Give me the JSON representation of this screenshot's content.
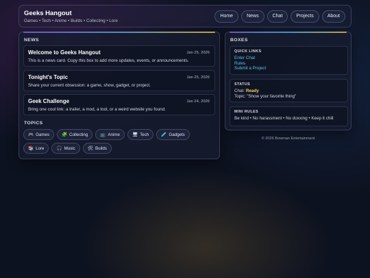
{
  "header": {
    "title": "Geeks Hangout",
    "tagline": "Games • Tech • Anime • Builds • Collecting • Lore",
    "nav": [
      "Home",
      "News",
      "Chat",
      "Projects",
      "About"
    ]
  },
  "news": {
    "heading": "NEWS",
    "cards": [
      {
        "title": "Welcome to Geeks Hangout",
        "date": "Jan 25, 2026",
        "body": "This is a news card. Copy this box to add more updates, events, or announcements."
      },
      {
        "title": "Tonight's Topic",
        "date": "Jan 25, 2026",
        "body": "Share your current obsession: a game, show, gadget, or project."
      },
      {
        "title": "Geek Challenge",
        "date": "Jan 24, 2026",
        "body": "Bring one cool link: a trailer, a mod, a tool, or a weird website you found."
      }
    ]
  },
  "topics": {
    "heading": "TOPICS",
    "chips": [
      {
        "icon": "🎮",
        "icon_name": "game-controller-icon",
        "label": "Games"
      },
      {
        "icon": "🧩",
        "icon_name": "puzzle-piece-icon",
        "label": "Collecting"
      },
      {
        "icon": "📺",
        "icon_name": "tv-icon",
        "label": "Anime"
      },
      {
        "icon": "🖥",
        "icon_name": "desktop-computer-icon",
        "label": "Tech"
      },
      {
        "icon": "🧪",
        "icon_name": "test-tube-icon",
        "label": "Gadgets"
      },
      {
        "icon": "📚",
        "icon_name": "books-icon",
        "label": "Lore"
      },
      {
        "icon": "🎧",
        "icon_name": "headphones-icon",
        "label": "Music"
      },
      {
        "icon": "🛠",
        "icon_name": "tools-icon",
        "label": "Builds"
      }
    ]
  },
  "boxes": {
    "heading": "BOXES",
    "quick_links": {
      "title": "QUICK LINKS",
      "links": [
        "Enter Chat",
        "Rules",
        "Submit a Project"
      ]
    },
    "status": {
      "title": "STATUS",
      "chat_label": "Chat:",
      "chat_value": "Ready",
      "topic_line": "Topic: \"Show your favorite thing\""
    },
    "mini_rules": {
      "title": "MINI RULES",
      "text": "Be kind • No harassment • No doxxing • Keep it chill"
    }
  },
  "footer": "© 2026 Bowman Entertainment",
  "colors": {
    "accent_link": "#56c8e8",
    "status_ready": "#f2d25a",
    "background": "#0d1220"
  }
}
